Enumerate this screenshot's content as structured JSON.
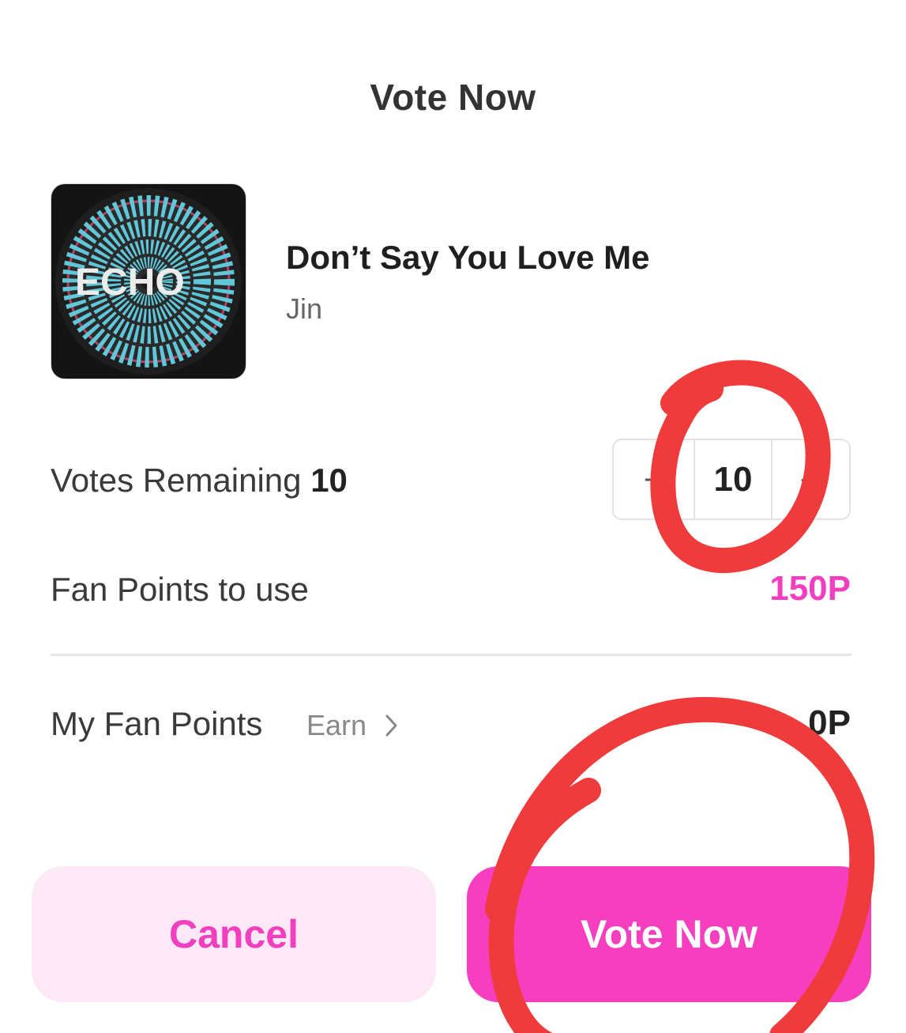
{
  "dialog": {
    "title": "Vote Now"
  },
  "song": {
    "title": "Don’t Say You Love Me",
    "artist": "Jin",
    "album_logo_text": "ECHO"
  },
  "votes": {
    "label": "Votes Remaining",
    "remaining": "10",
    "decrement_symbol": "−",
    "increment_symbol": "+",
    "selected_count": "10"
  },
  "fan_points_to_use": {
    "label": "Fan Points to use",
    "value": "150P"
  },
  "my_fan_points": {
    "label": "My Fan Points",
    "earn_label": "Earn",
    "value": "0P"
  },
  "buttons": {
    "cancel": "Cancel",
    "vote": "Vote Now"
  },
  "colors": {
    "accent": "#f53fbf",
    "cancel_bg": "#fde8f6",
    "annotation": "#ef3b3b"
  },
  "icons": {
    "earn": "chevron-right-icon"
  }
}
